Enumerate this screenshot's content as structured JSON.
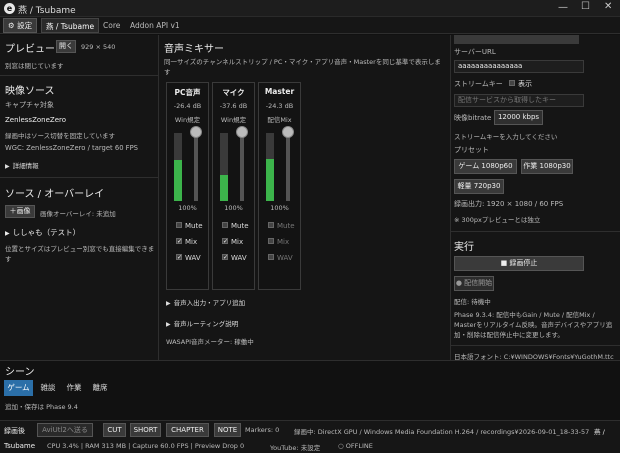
{
  "window": {
    "title": "燕 / Tsubame",
    "logo": "e"
  },
  "tabs": {
    "settings": "設定",
    "items": [
      "燕 / Tsubame",
      "Core",
      "Addon API v1"
    ]
  },
  "preview": {
    "title": "プレビュー",
    "open_btn": "開く",
    "size": "929 × 540",
    "status": "別窓は閉じています"
  },
  "video_source": {
    "title": "映像ソース",
    "capture_label": "キャプチャ対象",
    "target": "ZenlessZoneZero",
    "note": "録画中はソース切替を固定しています",
    "wgc": "WGC: ZenlessZoneZero / target 60 FPS",
    "details": "詳細情報"
  },
  "sources": {
    "title": "ソース / オーバーレイ",
    "add_image": "＋画像",
    "overlay_status": "画像オーバーレイ: 未追加",
    "item": "ししゃも（テスト）",
    "note": "位置とサイズはプレビュー別窓でも直接編集できます"
  },
  "mixer": {
    "title": "音声ミキサー",
    "desc": "同一サイズのチャンネルストリップ / PC・マイク・アプリ音声・Masterを同じ基準で表示します",
    "strips": [
      {
        "name": "PC音声",
        "db": "-26.4 dB",
        "mode": "Win規定",
        "pct": "100%",
        "level": 0.6,
        "mute": false,
        "mix": true,
        "wav": true,
        "dim": false
      },
      {
        "name": "マイク",
        "db": "-37.6 dB",
        "mode": "Win規定",
        "pct": "100%",
        "level": 0.38,
        "mute": false,
        "mix": true,
        "wav": true,
        "dim": false
      },
      {
        "name": "Master",
        "db": "-24.3 dB",
        "mode": "配信Mix",
        "pct": "100%",
        "level": 0.62,
        "mute": false,
        "mix": false,
        "wav": false,
        "dim": true
      }
    ],
    "labels": {
      "mute": "Mute",
      "mix": "Mix",
      "wav": "WAV"
    },
    "io": "音声入出力・アプリ追加",
    "routing": "音声ルーティング説明",
    "wasapi": "WASAPI音声メーター: 稼働中"
  },
  "right": {
    "server_label": "サーバーURL",
    "server_value": "aaaaaaaaaaaaaaa",
    "key_label": "ストリームキー",
    "show": "表示",
    "key_placeholder": "配信サービスから取得したキー",
    "bitrate_label": "映像bitrate",
    "bitrate": "12000 kbps",
    "key_hint": "ストリームキーを入力してください",
    "preset_label": "プリセット",
    "presets": [
      "ゲーム 1080p60",
      "作業 1080p30",
      "軽量 720p30"
    ],
    "record_info": "録画出力: 1920 × 1080 / 60 FPS",
    "preview_note": "※ 300pxプレビューとは独立",
    "exec_title": "実行",
    "stop_rec": "■ 録画停止",
    "start_stream": "● 配信開始",
    "stream_status": "配信: 待機中",
    "phase_note": "Phase 9.3.4: 配信中もGain / Mute / 配信Mix / Masterをリアルタイム反映。音声デバイスやアプリ追加・削除は配信停止中に変更します。",
    "font": "日本語フォント: C:¥WINDOWS¥Fonts¥YuGothM.ttc"
  },
  "scene": {
    "title": "シーン",
    "tabs": [
      "ゲーム",
      "雑談",
      "作業",
      "離席"
    ],
    "note": "追加・保存は Phase 9.4"
  },
  "status": {
    "recording": "録画後",
    "avi": "AviUtl2へ送る",
    "markers_btns": [
      "CUT",
      "SHORT",
      "CHAPTER",
      "NOTE"
    ],
    "markers": "Markers: 0",
    "rec_info": "録画中: DirectX GPU / Windows Media Foundation H.264 / recordings¥2026-09-01_18-33-57",
    "app": "燕 /",
    "app2": "Tsubame",
    "perf": "CPU 3.4% | RAM 313 MB | Capture 60.0 FPS | Preview Drop 0",
    "youtube": "YouTube: 未設定",
    "offline": "○ OFFLINE"
  }
}
